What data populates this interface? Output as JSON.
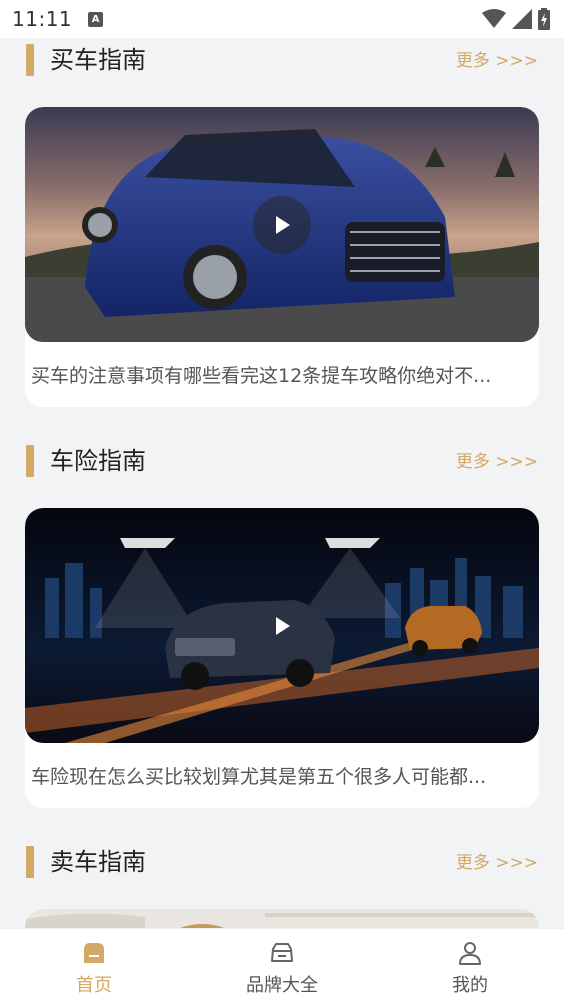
{
  "status_bar": {
    "time": "11:11",
    "notification_icon_letter": "A"
  },
  "sections": [
    {
      "title": "买车指南",
      "more_label": "更多 >>>",
      "card": {
        "caption": "买车的注意事项有哪些看完这12条提车攻略你绝对不..."
      }
    },
    {
      "title": "车险指南",
      "more_label": "更多 >>>",
      "card": {
        "caption": "车险现在怎么买比较划算尤其是第五个很多人可能都..."
      }
    },
    {
      "title": "卖车指南",
      "more_label": "更多 >>>"
    }
  ],
  "tab_bar": {
    "items": [
      {
        "label": "首页",
        "icon": "home-icon",
        "active": true
      },
      {
        "label": "品牌大全",
        "icon": "car-icon",
        "active": false
      },
      {
        "label": "我的",
        "icon": "user-icon",
        "active": false
      }
    ]
  },
  "colors": {
    "accent": "#d4a867",
    "background": "#f2f3f5",
    "card": "#ffffff"
  }
}
